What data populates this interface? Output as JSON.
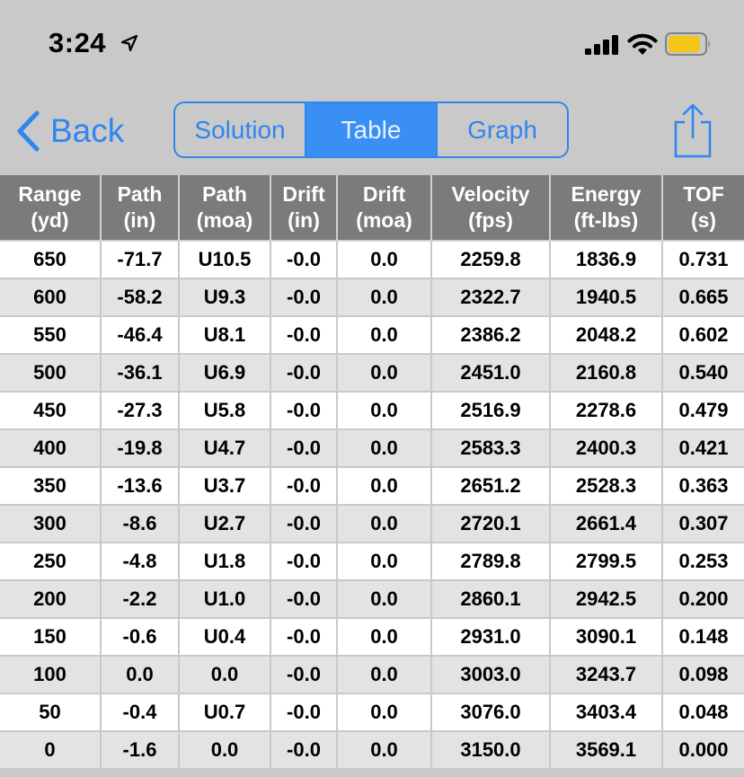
{
  "status_bar": {
    "time": "3:24",
    "icons": [
      "location-arrow-icon",
      "cellular-signal-icon",
      "wifi-icon",
      "battery-icon"
    ],
    "battery_color": "#f5c518"
  },
  "nav": {
    "back_label": "Back",
    "segments": [
      {
        "label": "Solution",
        "active": false
      },
      {
        "label": "Table",
        "active": true
      },
      {
        "label": "Graph",
        "active": false
      }
    ],
    "accent_color": "#2f86f0"
  },
  "table": {
    "headers": [
      {
        "line1": "Range",
        "line2": "(yd)"
      },
      {
        "line1": "Path",
        "line2": "(in)"
      },
      {
        "line1": "Path",
        "line2": "(moa)"
      },
      {
        "line1": "Drift",
        "line2": "(in)"
      },
      {
        "line1": "Drift",
        "line2": "(moa)"
      },
      {
        "line1": "Velocity",
        "line2": "(fps)"
      },
      {
        "line1": "Energy",
        "line2": "(ft-lbs)"
      },
      {
        "line1": "TOF",
        "line2": "(s)"
      }
    ],
    "rows": [
      [
        "650",
        "-71.7",
        "U10.5",
        "-0.0",
        "0.0",
        "2259.8",
        "1836.9",
        "0.731"
      ],
      [
        "600",
        "-58.2",
        "U9.3",
        "-0.0",
        "0.0",
        "2322.7",
        "1940.5",
        "0.665"
      ],
      [
        "550",
        "-46.4",
        "U8.1",
        "-0.0",
        "0.0",
        "2386.2",
        "2048.2",
        "0.602"
      ],
      [
        "500",
        "-36.1",
        "U6.9",
        "-0.0",
        "0.0",
        "2451.0",
        "2160.8",
        "0.540"
      ],
      [
        "450",
        "-27.3",
        "U5.8",
        "-0.0",
        "0.0",
        "2516.9",
        "2278.6",
        "0.479"
      ],
      [
        "400",
        "-19.8",
        "U4.7",
        "-0.0",
        "0.0",
        "2583.3",
        "2400.3",
        "0.421"
      ],
      [
        "350",
        "-13.6",
        "U3.7",
        "-0.0",
        "0.0",
        "2651.2",
        "2528.3",
        "0.363"
      ],
      [
        "300",
        "-8.6",
        "U2.7",
        "-0.0",
        "0.0",
        "2720.1",
        "2661.4",
        "0.307"
      ],
      [
        "250",
        "-4.8",
        "U1.8",
        "-0.0",
        "0.0",
        "2789.8",
        "2799.5",
        "0.253"
      ],
      [
        "200",
        "-2.2",
        "U1.0",
        "-0.0",
        "0.0",
        "2860.1",
        "2942.5",
        "0.200"
      ],
      [
        "150",
        "-0.6",
        "U0.4",
        "-0.0",
        "0.0",
        "2931.0",
        "3090.1",
        "0.148"
      ],
      [
        "100",
        "0.0",
        "0.0",
        "-0.0",
        "0.0",
        "3003.0",
        "3243.7",
        "0.098"
      ],
      [
        "50",
        "-0.4",
        "U0.7",
        "-0.0",
        "0.0",
        "3076.0",
        "3403.4",
        "0.048"
      ],
      [
        "0",
        "-1.6",
        "0.0",
        "-0.0",
        "0.0",
        "3150.0",
        "3569.1",
        "0.000"
      ]
    ]
  }
}
